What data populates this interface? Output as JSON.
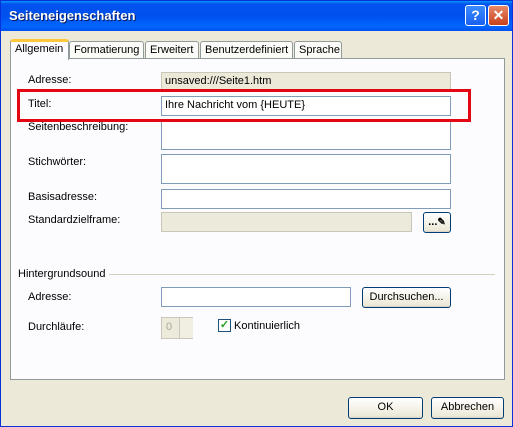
{
  "window": {
    "title": "Seiteneigenschaften",
    "help_glyph": "?",
    "close_glyph": "✕"
  },
  "tabs": [
    "Allgemein",
    "Formatierung",
    "Erweitert",
    "Benutzerdefiniert",
    "Sprache"
  ],
  "general": {
    "address_label": "Adresse:",
    "address_value": "unsaved:///Seite1.htm",
    "title_label": "Titel:",
    "title_value": "Ihre Nachricht vom {HEUTE}",
    "description_label": "Seitenbeschreibung:",
    "keywords_label": "Stichwörter:",
    "base_label": "Basisadresse:",
    "target_label": "Standardzielframe:",
    "target_button": "..."
  },
  "sound": {
    "group_label": "Hintergrundsound",
    "address_label": "Adresse:",
    "browse_button": "Durchsuchen...",
    "loops_label": "Durchläufe:",
    "loops_value": "0",
    "continuous_label": "Kontinuierlich",
    "continuous_checked": true
  },
  "buttons": {
    "ok": "OK",
    "cancel": "Abbrechen"
  },
  "colors": {
    "highlight": "#e30613",
    "titlebar": "#0053ee"
  }
}
